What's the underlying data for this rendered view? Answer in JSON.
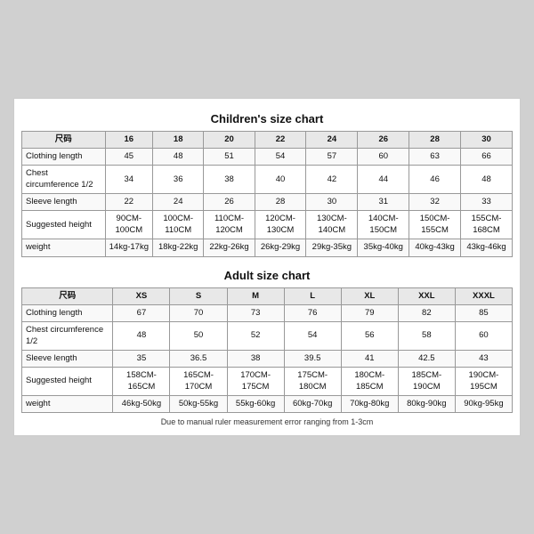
{
  "children_chart": {
    "title": "Children's size chart",
    "columns": [
      "尺码",
      "16",
      "18",
      "20",
      "22",
      "24",
      "26",
      "28",
      "30"
    ],
    "rows": [
      {
        "label": "Clothing length",
        "values": [
          "45",
          "48",
          "51",
          "54",
          "57",
          "60",
          "63",
          "66"
        ]
      },
      {
        "label": "Chest circumference 1/2",
        "values": [
          "34",
          "36",
          "38",
          "40",
          "42",
          "44",
          "46",
          "48"
        ]
      },
      {
        "label": "Sleeve length",
        "values": [
          "22",
          "24",
          "26",
          "28",
          "30",
          "31",
          "32",
          "33"
        ]
      },
      {
        "label": "Suggested height",
        "values": [
          "90CM-100CM",
          "100CM-110CM",
          "110CM-120CM",
          "120CM-130CM",
          "130CM-140CM",
          "140CM-150CM",
          "150CM-155CM",
          "155CM-168CM"
        ]
      },
      {
        "label": "weight",
        "values": [
          "14kg-17kg",
          "18kg-22kg",
          "22kg-26kg",
          "26kg-29kg",
          "29kg-35kg",
          "35kg-40kg",
          "40kg-43kg",
          "43kg-46kg"
        ]
      }
    ]
  },
  "adult_chart": {
    "title": "Adult size chart",
    "columns": [
      "尺码",
      "XS",
      "S",
      "M",
      "L",
      "XL",
      "XXL",
      "XXXL"
    ],
    "rows": [
      {
        "label": "Clothing length",
        "values": [
          "67",
          "70",
          "73",
          "76",
          "79",
          "82",
          "85"
        ]
      },
      {
        "label": "Chest circumference 1/2",
        "values": [
          "48",
          "50",
          "52",
          "54",
          "56",
          "58",
          "60"
        ]
      },
      {
        "label": "Sleeve length",
        "values": [
          "35",
          "36.5",
          "38",
          "39.5",
          "41",
          "42.5",
          "43"
        ]
      },
      {
        "label": "Suggested height",
        "values": [
          "158CM-165CM",
          "165CM-170CM",
          "170CM-175CM",
          "175CM-180CM",
          "180CM-185CM",
          "185CM-190CM",
          "190CM-195CM"
        ]
      },
      {
        "label": "weight",
        "values": [
          "46kg-50kg",
          "50kg-55kg",
          "55kg-60kg",
          "60kg-70kg",
          "70kg-80kg",
          "80kg-90kg",
          "90kg-95kg"
        ]
      }
    ]
  },
  "footnote": "Due to manual ruler measurement error ranging from 1-3cm"
}
